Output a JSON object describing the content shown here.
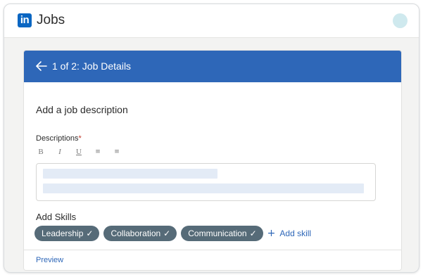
{
  "app": {
    "logo_text": "in",
    "title": "Jobs",
    "brand_color": "#0a66c2"
  },
  "header": {
    "back_icon": "arrow-left-icon",
    "step_title": "1 of 2: Job Details",
    "color": "#2e67b8"
  },
  "form": {
    "section_title": "Add a job description",
    "description_label": "Descriptions",
    "required_marker": "*",
    "toolbar": [
      {
        "name": "bold",
        "glyph": "B"
      },
      {
        "name": "italic",
        "glyph": "I"
      },
      {
        "name": "underline",
        "glyph": "U"
      },
      {
        "name": "bulleted-list",
        "glyph": "≡"
      },
      {
        "name": "numbered-list",
        "glyph": "≡"
      }
    ],
    "skills_title": "Add Skills",
    "skills": [
      {
        "label": "Leadership",
        "check": "✓"
      },
      {
        "label": "Collaboration",
        "check": "✓"
      },
      {
        "label": "Communication",
        "check": "✓"
      }
    ],
    "add_skill_plus": "+",
    "add_skill_label": "Add skill",
    "chip_color": "#566b78"
  },
  "footer": {
    "preview_label": "Preview"
  }
}
